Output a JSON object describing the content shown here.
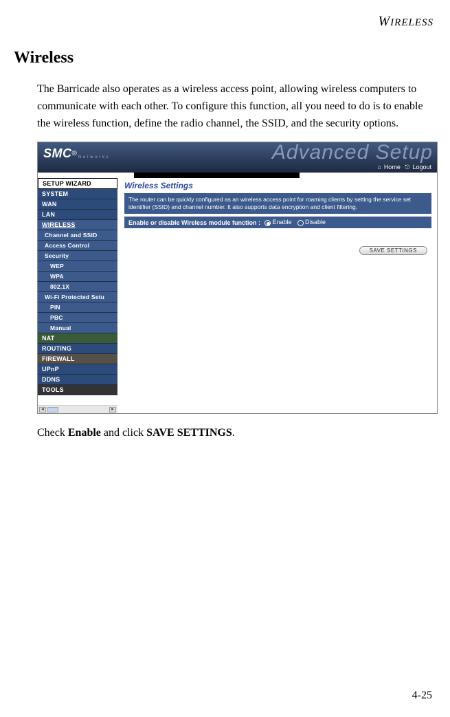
{
  "header_label_cap": "W",
  "header_label_rest": "IRELESS",
  "section_title": "Wireless",
  "intro_paragraph": "The Barricade also operates as a wireless access point, allowing wireless computers to communicate with each other. To configure this function, all you need to do is to enable the wireless function, define the radio channel, the SSID, and the security options.",
  "screenshot": {
    "logo_main": "SMC",
    "logo_sub": "N e t w o r k s",
    "banner": "Advanced Setup",
    "top_links": {
      "home": "Home",
      "logout": "Logout"
    },
    "sidebar": {
      "setup_wizard": "SETUP WIZARD",
      "system": "SYSTEM",
      "wan": "WAN",
      "lan": "LAN",
      "wireless": "WIRELESS",
      "channel_ssid": "Channel and SSID",
      "access_control": "Access Control",
      "security": "Security",
      "wep": "WEP",
      "wpa": "WPA",
      "dot1x": "802.1X",
      "wps": "Wi-Fi Protected Setu",
      "pin": "PIN",
      "pbc": "PBC",
      "manual": "Manual",
      "nat": "NAT",
      "routing": "ROUTING",
      "firewall": "FIREWALL",
      "upnp": "UPnP",
      "ddns": "DDNS",
      "tools": "TOOLS"
    },
    "content": {
      "title": "Wireless Settings",
      "desc": "The router can be quickly configured as an wireless access point for roaming clients by setting the service set identifier (SSID) and channel number. It also supports data encryption and client filtering.",
      "enable_label": "Enable or disable Wireless module function :",
      "opt_enable": "Enable",
      "opt_disable": "Disable",
      "save_button": "SAVE SETTINGS"
    }
  },
  "caption_prefix": "Check ",
  "caption_bold1": "Enable",
  "caption_mid": " and click ",
  "caption_bold2": "SAVE SETTINGS",
  "caption_suffix": ".",
  "page_number": "4-25"
}
